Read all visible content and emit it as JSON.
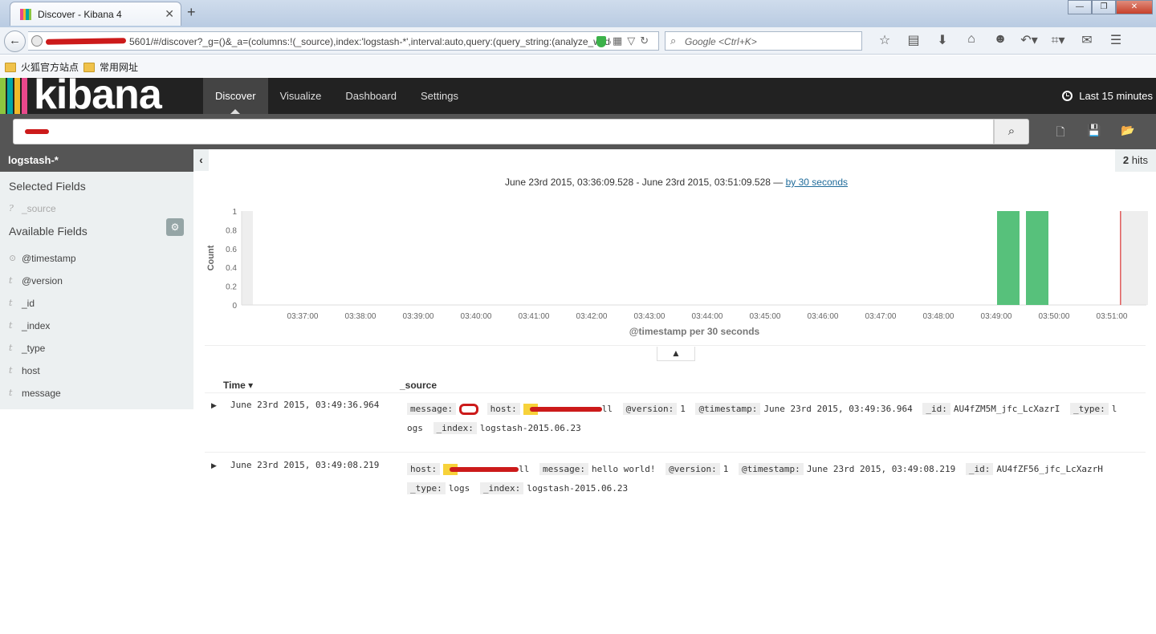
{
  "browser": {
    "tab_title": "Discover - Kibana 4",
    "tab_close": "✕",
    "new_tab": "+",
    "url": "5601/#/discover?_g=()&_a=(columns:!(_source),index:'logstash-*',interval:auto,query:(query_string:(analyze_wildca",
    "search_placeholder": "Google <Ctrl+K>",
    "bookmarks": [
      "火狐官方站点",
      "常用网址"
    ],
    "window_buttons": [
      "—",
      "❐",
      "✕"
    ]
  },
  "kibana": {
    "logo": "kibana",
    "nav": [
      "Discover",
      "Visualize",
      "Dashboard",
      "Settings"
    ],
    "active_nav": "Discover",
    "time_picker": "Last 15 minutes"
  },
  "sidebar": {
    "index_pattern": "logstash-*",
    "selected_fields_title": "Selected Fields",
    "selected_fields": [
      {
        "type": "?",
        "name": "_source"
      }
    ],
    "available_fields_title": "Available Fields",
    "available_fields": [
      {
        "type": "clock",
        "name": "@timestamp"
      },
      {
        "type": "t",
        "name": "@version"
      },
      {
        "type": "t",
        "name": "_id"
      },
      {
        "type": "t",
        "name": "_index"
      },
      {
        "type": "t",
        "name": "_type"
      },
      {
        "type": "t",
        "name": "host"
      },
      {
        "type": "t",
        "name": "message"
      }
    ]
  },
  "main": {
    "hits_count": "2",
    "hits_label": "hits",
    "range_text": "June 23rd 2015, 03:36:09.528 - June 23rd 2015, 03:51:09.528 —",
    "interval_link": "by 30 seconds",
    "columns": {
      "time": "Time",
      "source": "_source"
    },
    "documents": [
      {
        "time": "June 23rd 2015, 03:49:36.964",
        "fields_line1": [
          {
            "key": "message:",
            "val": "",
            "redact": "circle"
          },
          {
            "key": "host:",
            "val": "ll",
            "redact": "yellow-line"
          },
          {
            "key": "@version:",
            "val": "1"
          },
          {
            "key": "@timestamp:",
            "val": "June 23rd 2015, 03:49:36.964"
          },
          {
            "key": "_id:",
            "val": "AU4fZM5M_jfc_LcXazrI"
          },
          {
            "key": "_type:",
            "val": "l"
          }
        ],
        "fields_line2": [
          {
            "key": "",
            "val": "ogs"
          },
          {
            "key": "_index:",
            "val": "logstash-2015.06.23"
          }
        ]
      },
      {
        "time": "June 23rd 2015, 03:49:08.219",
        "fields_line1": [
          {
            "key": "host:",
            "val": "ll",
            "redact": "yellow-line"
          },
          {
            "key": "message:",
            "val": "hello world!"
          },
          {
            "key": "@version:",
            "val": "1"
          },
          {
            "key": "@timestamp:",
            "val": "June 23rd 2015, 03:49:08.219"
          },
          {
            "key": "_id:",
            "val": "AU4fZF56_jfc_LcXazrH"
          }
        ],
        "fields_line2": [
          {
            "key": "_type:",
            "val": "logs"
          },
          {
            "key": "_index:",
            "val": "logstash-2015.06.23"
          }
        ]
      }
    ]
  },
  "chart_data": {
    "type": "bar",
    "xlabel": "@timestamp per 30 seconds",
    "ylabel": "Count",
    "ylim": [
      0,
      1
    ],
    "yticks": [
      "0",
      "0.2",
      "0.4",
      "0.6",
      "0.8",
      "1"
    ],
    "xticks": [
      "03:37:00",
      "03:38:00",
      "03:39:00",
      "03:40:00",
      "03:41:00",
      "03:42:00",
      "03:43:00",
      "03:44:00",
      "03:45:00",
      "03:46:00",
      "03:47:00",
      "03:48:00",
      "03:49:00",
      "03:50:00",
      "03:51:00"
    ],
    "series": [
      {
        "values": [
          {
            "x": "03:49:00",
            "y": 1
          },
          {
            "x": "03:49:30",
            "y": 1
          }
        ]
      }
    ],
    "bar_color": "#57c17b",
    "now_marker": "03:51:09.528"
  }
}
